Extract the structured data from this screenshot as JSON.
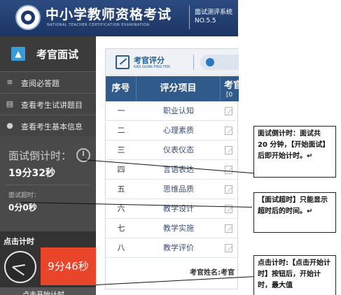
{
  "header": {
    "title": "中小学教师资格考试",
    "subtitle": "NATIONAL TEACHER CERTIFICATION EXAMINATION",
    "right_title": "面试测评系统",
    "version": "NO.5.5"
  },
  "sidebar": {
    "heading": "考官面试",
    "items": [
      {
        "label": "查阅必答题",
        "icon": "stack-icon"
      },
      {
        "label": "查看考生试讲题目",
        "icon": "document-icon"
      },
      {
        "label": "查看考生基本信息",
        "icon": "person-icon"
      }
    ],
    "countdown": {
      "label": "面试倒计时：",
      "value": "19分32秒"
    },
    "overtime": {
      "label": "面试超时：",
      "value": "0分0秒"
    },
    "click_timer": {
      "label": "点击计时",
      "value": "9分46秒",
      "start_label": "点击开始计时"
    }
  },
  "score_panel": {
    "title": "考官评分",
    "subtitle": "KAO GUAN PING FEN",
    "headers": {
      "index": "序号",
      "item": "评分项目",
      "score": "考官",
      "score_sub": "[0"
    },
    "rows": [
      {
        "index": "一",
        "item": "职业认知"
      },
      {
        "index": "二",
        "item": "心理素质"
      },
      {
        "index": "三",
        "item": "仪表仪态"
      },
      {
        "index": "四",
        "item": "言语表达"
      },
      {
        "index": "五",
        "item": "思维品质"
      },
      {
        "index": "六",
        "item": "教学设计"
      },
      {
        "index": "七",
        "item": "教学实施"
      },
      {
        "index": "八",
        "item": "教学评价"
      }
    ],
    "examiner_label": "考官姓名:考官"
  },
  "callouts": [
    {
      "text": "面试倒计时：面试共 20 分钟，【开始面试】后即开始计时。↵"
    },
    {
      "text": "【面试超时】只能显示超时后的时间。↵"
    },
    {
      "text": "点击计时:【点击开始计时】按钮后，开始计时，最大值"
    }
  ],
  "colors": {
    "header_bg": "#1b3563",
    "sidebar_bg": "#4a4a4a",
    "table_header_bg": "#2f5a8a",
    "timer_red": "#e8452a",
    "accent_blue": "#3b9bd6"
  }
}
